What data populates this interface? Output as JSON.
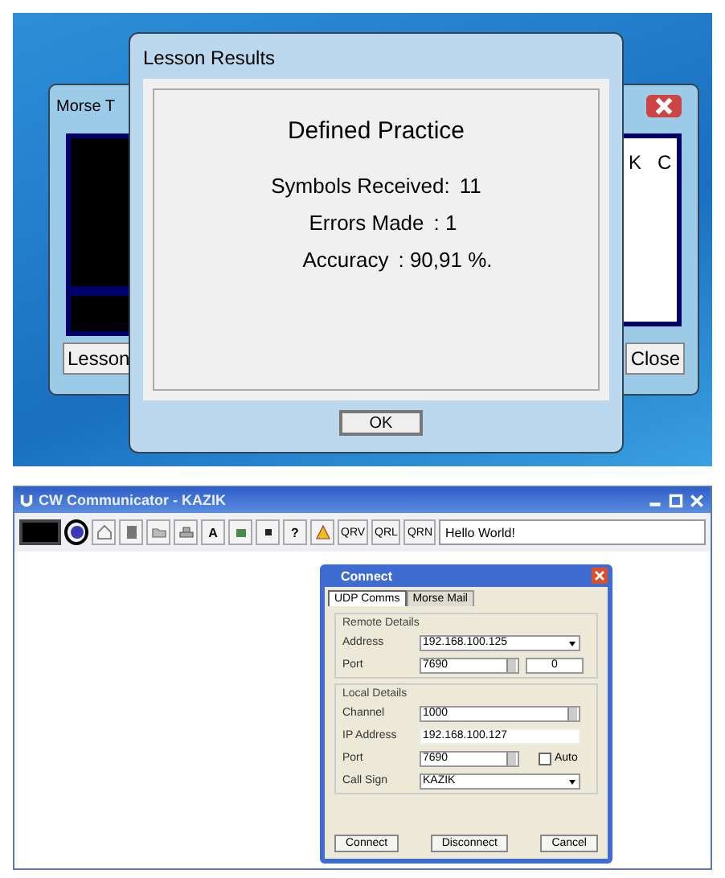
{
  "top_screen": {
    "back_window": {
      "title": "Morse T",
      "letters": [
        "K",
        "C"
      ],
      "left_button": "Lesson",
      "right_button": "Close"
    },
    "dialog": {
      "title": "Lesson Results",
      "heading": "Defined Practice",
      "stats": [
        {
          "label": "Symbols Received:",
          "value": "11"
        },
        {
          "label": "Errors Made",
          "value": ": 1"
        },
        {
          "label": "Accuracy",
          "value": ": 90,91 %."
        }
      ],
      "ok_button": "OK"
    }
  },
  "bottom_screen": {
    "title": "CW Communicator - KAZIK",
    "toolbar": [
      {
        "kind": "display"
      },
      {
        "kind": "icon",
        "selected": true
      },
      {
        "kind": "icon",
        "selected": false
      },
      {
        "kind": "icon",
        "selected": false
      },
      {
        "kind": "icon",
        "selected": false
      },
      {
        "kind": "icon",
        "selected": false
      },
      {
        "kind": "text",
        "label": "A"
      },
      {
        "kind": "icon",
        "selected": false
      },
      {
        "kind": "icon",
        "selected": false
      },
      {
        "kind": "text",
        "label": "?"
      },
      {
        "kind": "icon",
        "selected": false
      },
      {
        "kind": "text",
        "label": "QRV"
      },
      {
        "kind": "text",
        "label": "QRL"
      },
      {
        "kind": "text",
        "label": "QRN"
      }
    ],
    "message": "Hello World!",
    "connect": {
      "title": "Connect",
      "tabs": [
        {
          "label": "UDP Comms",
          "selected": true
        },
        {
          "label": "Morse Mail",
          "selected": false
        }
      ],
      "groups": [
        {
          "title": "Remote Details",
          "rows": [
            {
              "label": "Address",
              "kind": "dropdown",
              "value": "192.168.100.125"
            },
            {
              "label": "Port",
              "kind": "spinner",
              "value": "7690",
              "extra": "0"
            }
          ]
        },
        {
          "title": "Local Details",
          "rows": [
            {
              "label": "Channel",
              "kind": "spinner",
              "value": "1000"
            },
            {
              "label": "IP Address",
              "kind": "text",
              "value": "192.168.100.127"
            },
            {
              "label": "Port",
              "kind": "spinner",
              "value": "7690",
              "check": {
                "label": "Auto",
                "checked": false
              }
            },
            {
              "label": "Call Sign",
              "kind": "dropdown",
              "value": "KAZIK"
            }
          ]
        }
      ],
      "buttons": [
        "Connect",
        "Disconnect",
        "Cancel"
      ]
    }
  }
}
